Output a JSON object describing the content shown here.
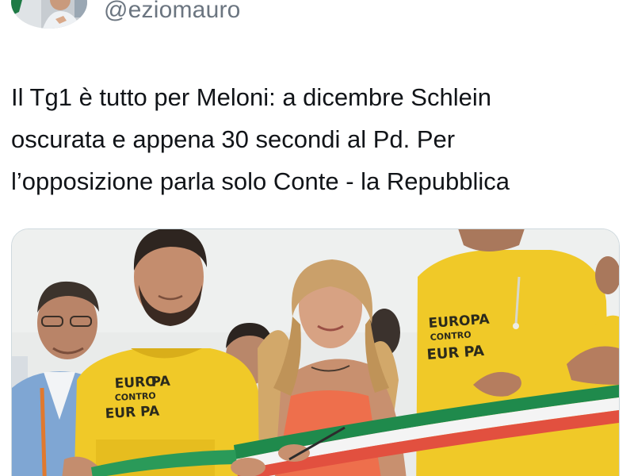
{
  "author": {
    "handle": "@eziomauro"
  },
  "tweet": {
    "lines": [
      "Il Tg1 è tutto per Meloni: a dicembre Schlein",
      "oscurata e appena 30 secondi al Pd. Per",
      "l’opposizione parla solo Conte - la Repubblica"
    ]
  },
  "media": {
    "shirt_print": {
      "line1": "EUROPA",
      "line2": "CONTRO",
      "line3": "EUR PA"
    }
  },
  "colors": {
    "handle": "#6b7580",
    "text": "#111418",
    "card_border": "#cfd9de",
    "shirt": "#f3cf2c",
    "dress": "#ee6f4c",
    "ribbon_green": "#1f8a4c",
    "ribbon_white": "#f4f4f4",
    "ribbon_red": "#e2503f"
  },
  "icons": {
    "avatar": "profile-photo-avatar"
  }
}
